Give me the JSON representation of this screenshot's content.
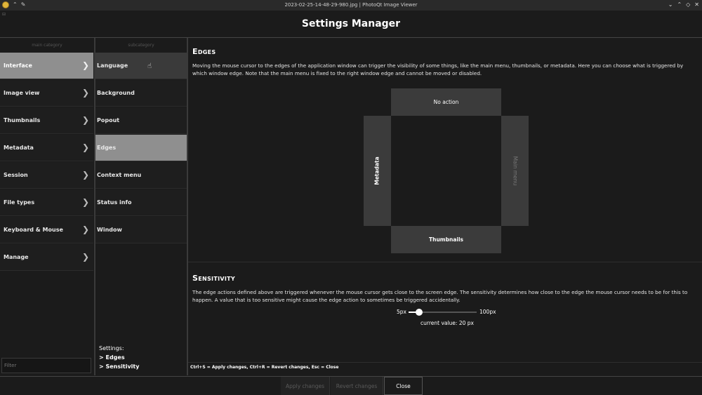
{
  "window": {
    "title": "2023-02-25-14-48-29-980.jpg | PhotoQt Image Viewer",
    "controls": [
      "⌄",
      "⌃",
      "◇",
      "✕"
    ]
  },
  "header": {
    "title": "Settings Manager"
  },
  "main_column": {
    "heading": "main category",
    "items": [
      {
        "label": "Interface"
      },
      {
        "label": "Image view"
      },
      {
        "label": "Thumbnails"
      },
      {
        "label": "Metadata"
      },
      {
        "label": "Session"
      },
      {
        "label": "File types"
      },
      {
        "label": "Keyboard & Mouse"
      },
      {
        "label": "Manage"
      }
    ],
    "active_index": 0,
    "filter_placeholder": "Filter"
  },
  "sub_column": {
    "heading": "subcategory",
    "items": [
      {
        "label": "Language"
      },
      {
        "label": "Background"
      },
      {
        "label": "Popout"
      },
      {
        "label": "Edges"
      },
      {
        "label": "Context menu"
      },
      {
        "label": "Status info"
      },
      {
        "label": "Window"
      }
    ],
    "active_index": 3,
    "settings_heading": "Settings:",
    "settings_items": [
      "> Edges",
      "> Sensitivity"
    ]
  },
  "edges_section": {
    "title": "Edges",
    "description": "Moving the mouse cursor to the edges of the application window can trigger the visibility of some things, like the main menu, thumbnails, or metadata. Here you can choose what is triggered by which window edge. Note that the main menu is fixed to the right window edge and cannot be moved or disabled.",
    "top": "No action",
    "left": "Metadata",
    "right": "Main menu",
    "bottom": "Thumbnails"
  },
  "sensitivity_section": {
    "title": "Sensitivity",
    "description": "The edge actions defined above are triggered whenever the mouse cursor gets close to the screen edge. The sensitivity determines how close to the edge the mouse cursor needs to be for this to happen. A value that is too sensitive might cause the edge action to sometimes be triggered accidentally.",
    "min_label": "5px",
    "max_label": "100px",
    "value": 20,
    "min": 5,
    "max": 100,
    "current_label": "current value: 20 px"
  },
  "shortcuts": "Ctrl+S = Apply changes, Ctrl+R = Revert changes, Esc = Close",
  "buttons": {
    "apply": "Apply changes",
    "revert": "Revert changes",
    "close": "Close"
  }
}
